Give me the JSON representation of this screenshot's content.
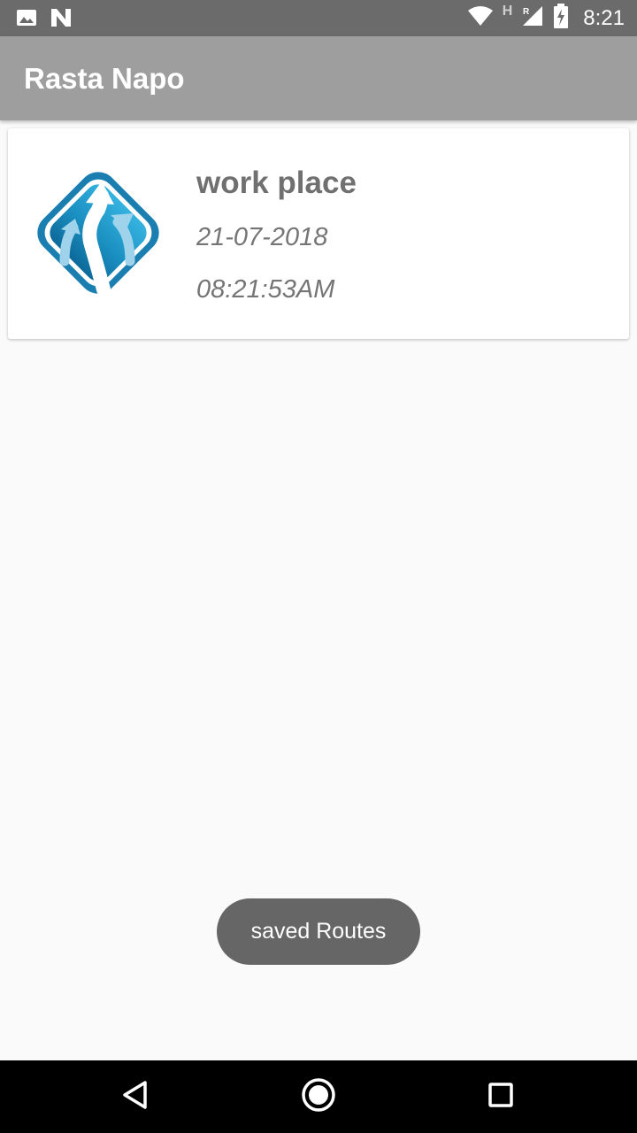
{
  "status_bar": {
    "time": "8:21",
    "roaming_indicator": "H",
    "icons": [
      "image-icon",
      "n-icon",
      "wifi-icon",
      "signal-icon",
      "battery-charging-icon"
    ]
  },
  "app_bar": {
    "title": "Rasta Napo"
  },
  "routes": [
    {
      "name": "work place",
      "date": "21-07-2018",
      "time": "08:21:53AM",
      "icon": "route-logo-icon"
    }
  ],
  "toast": {
    "message": "saved Routes"
  },
  "nav_bar": {
    "buttons": [
      "back-icon",
      "home-icon",
      "recents-icon"
    ]
  },
  "colors": {
    "status_bar": "#6b6b6b",
    "app_bar": "#9e9e9e",
    "background": "#fafafa",
    "logo_blue": "#1a8fc1",
    "toast": "#666666"
  }
}
